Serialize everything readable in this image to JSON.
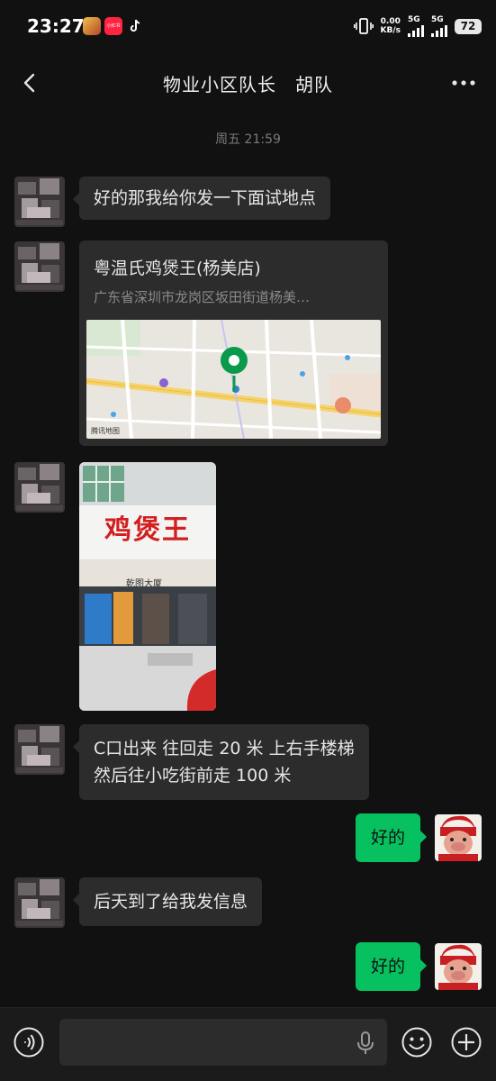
{
  "status_bar": {
    "time": "23:27",
    "app_badge": "小红书",
    "net_speed_value": "0.00",
    "net_speed_unit": "KB/s",
    "network_1": "5G",
    "network_2": "5G",
    "battery": "72"
  },
  "header": {
    "title": "物业小区队长　胡队",
    "back_icon": "chevron-left-icon",
    "more_icon": "more-dots-icon"
  },
  "chat": {
    "timestamp": "周五 21:59",
    "messages": [
      {
        "type": "text",
        "from": "contact",
        "text": "好的那我给你发一下面试地点"
      },
      {
        "type": "location",
        "from": "contact",
        "name": "粤温氏鸡煲王(杨美店)",
        "address": "广东省深圳市龙岗区坂田街道杨美…",
        "map_credit": "腾讯地图"
      },
      {
        "type": "image",
        "from": "contact",
        "sign_text": "鸡煲王",
        "sub_sign": "乾图大厦"
      },
      {
        "type": "text",
        "from": "contact",
        "lines": [
          "C口出来 往回走 20 米 上右手楼梯",
          "然后往小吃街前走 100 米"
        ]
      },
      {
        "type": "text",
        "from": "me",
        "text": "好的"
      },
      {
        "type": "text",
        "from": "contact",
        "text": "后天到了给我发信息"
      },
      {
        "type": "text",
        "from": "me",
        "text": "好的"
      }
    ]
  },
  "input_bar": {
    "voice_toggle_icon": "voice-wave-icon",
    "mic_icon": "microphone-icon",
    "emoji_icon": "emoji-icon",
    "plus_icon": "plus-circle-icon"
  },
  "colors": {
    "background": "#111111",
    "incoming_bubble": "#2c2c2c",
    "outgoing_bubble": "#07c160",
    "map_pin": "#0a9a4c"
  }
}
